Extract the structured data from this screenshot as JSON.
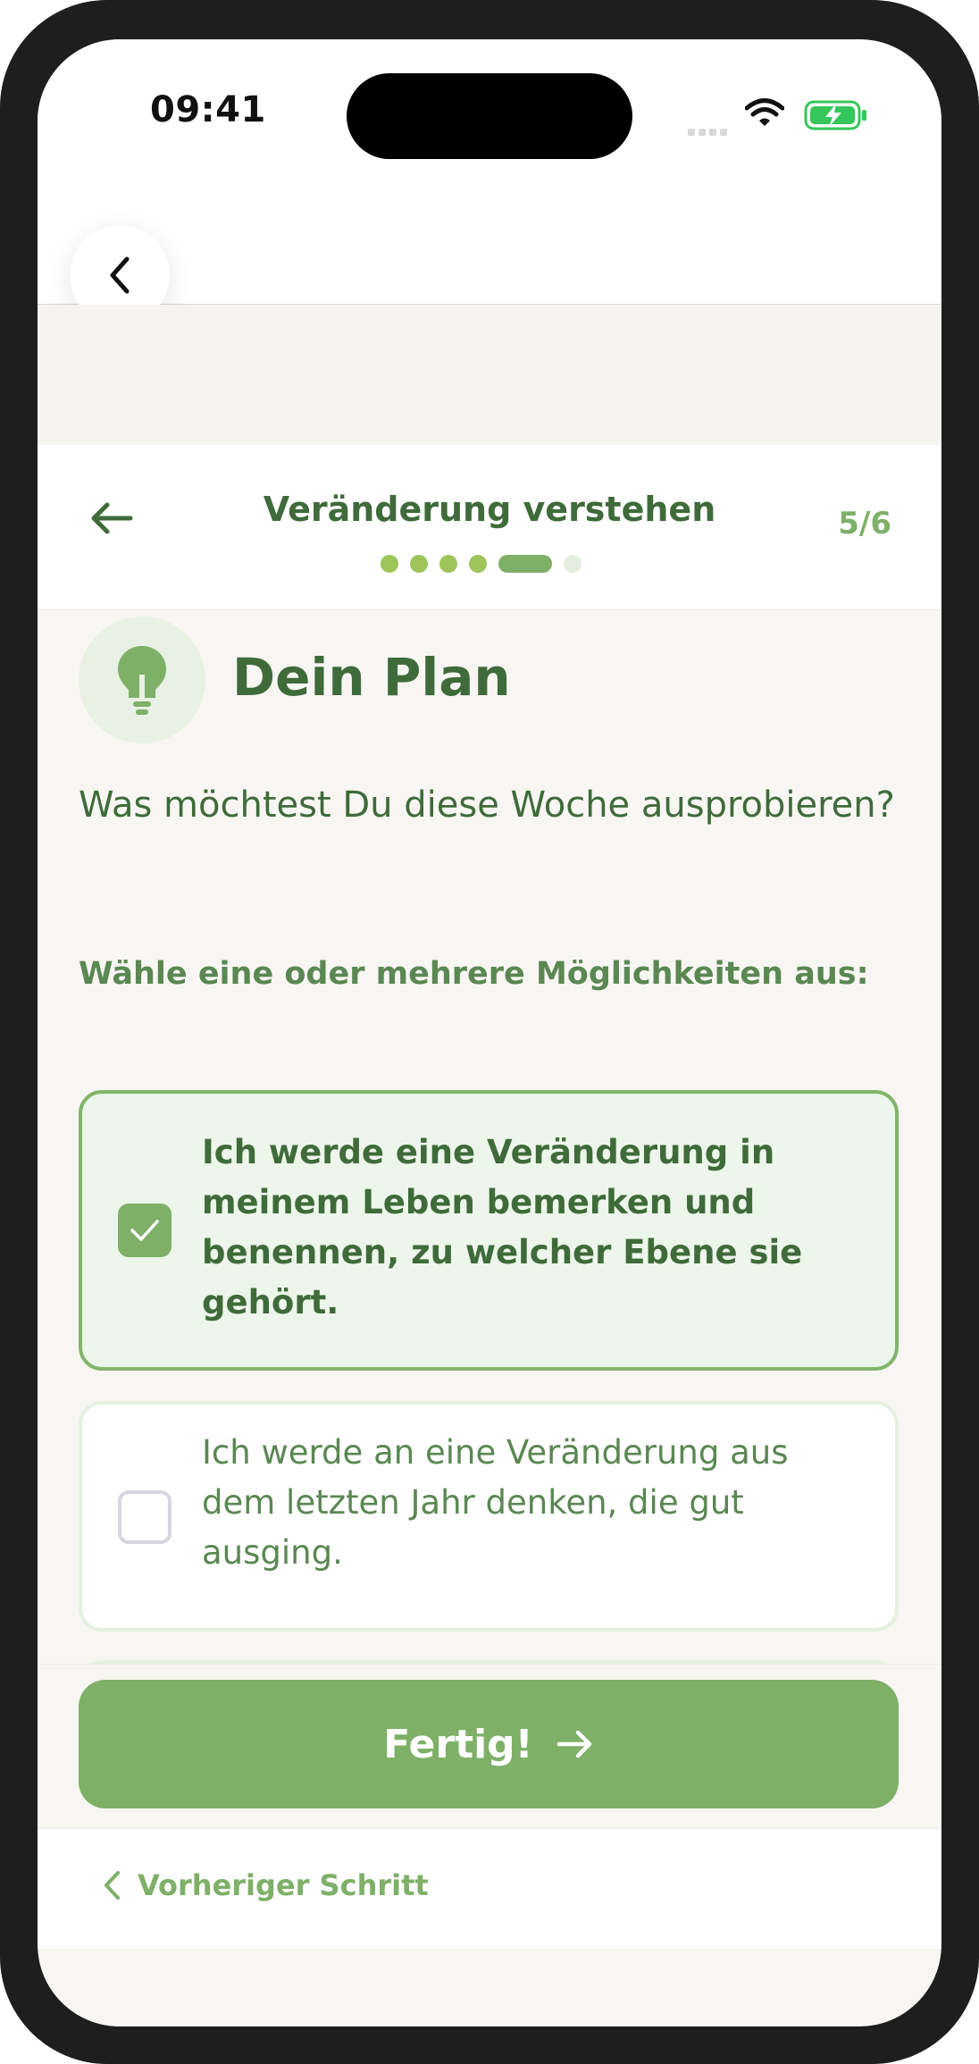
{
  "status_bar": {
    "time": "09:41"
  },
  "lesson": {
    "title": "Veränderung verstehen",
    "step": "5/6",
    "progress": {
      "current": 5,
      "total": 6
    }
  },
  "content": {
    "icon": "lightbulb-icon",
    "heading": "Dein Plan",
    "question": "Was möchtest Du diese Woche ausprobieren?",
    "instruction": "Wähle eine oder mehrere Möglichkeiten aus:",
    "options": [
      {
        "text": "Ich werde eine Veränderung in meinem Leben bemerken und benennen, zu welcher Ebene sie gehört.",
        "checked": true
      },
      {
        "text": "Ich werde an eine Veränderung aus dem letzten Jahr denken, die gut ausging.",
        "checked": false
      }
    ]
  },
  "actions": {
    "done_label": "Fertig!",
    "prev_label": "Vorheriger Schritt"
  },
  "colors": {
    "accent": "#7eb068",
    "dark_green": "#3f6b3a",
    "selected_bg": "#edf6ea",
    "background": "#f8f6f3"
  }
}
